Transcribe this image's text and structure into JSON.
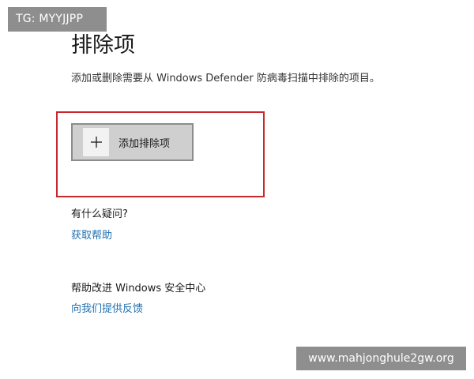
{
  "watermarks": {
    "top_left": "TG: MYYJJPP",
    "bottom_right": "www.mahjonghule2gw.org"
  },
  "page": {
    "title": "排除项",
    "description": "添加或删除需要从 Windows Defender 防病毒扫描中排除的项目。"
  },
  "add_exclusion": {
    "label": "添加排除项",
    "icon": "plus-icon"
  },
  "colors": {
    "highlight_border": "#c8282d",
    "link": "#1f6fb0",
    "button_bg": "#cfcfcf"
  },
  "help_section": {
    "heading": "有什么疑问?",
    "link_label": "获取帮助"
  },
  "improve_section": {
    "heading": "帮助改进 Windows 安全中心",
    "link_label": "向我们提供反馈"
  }
}
